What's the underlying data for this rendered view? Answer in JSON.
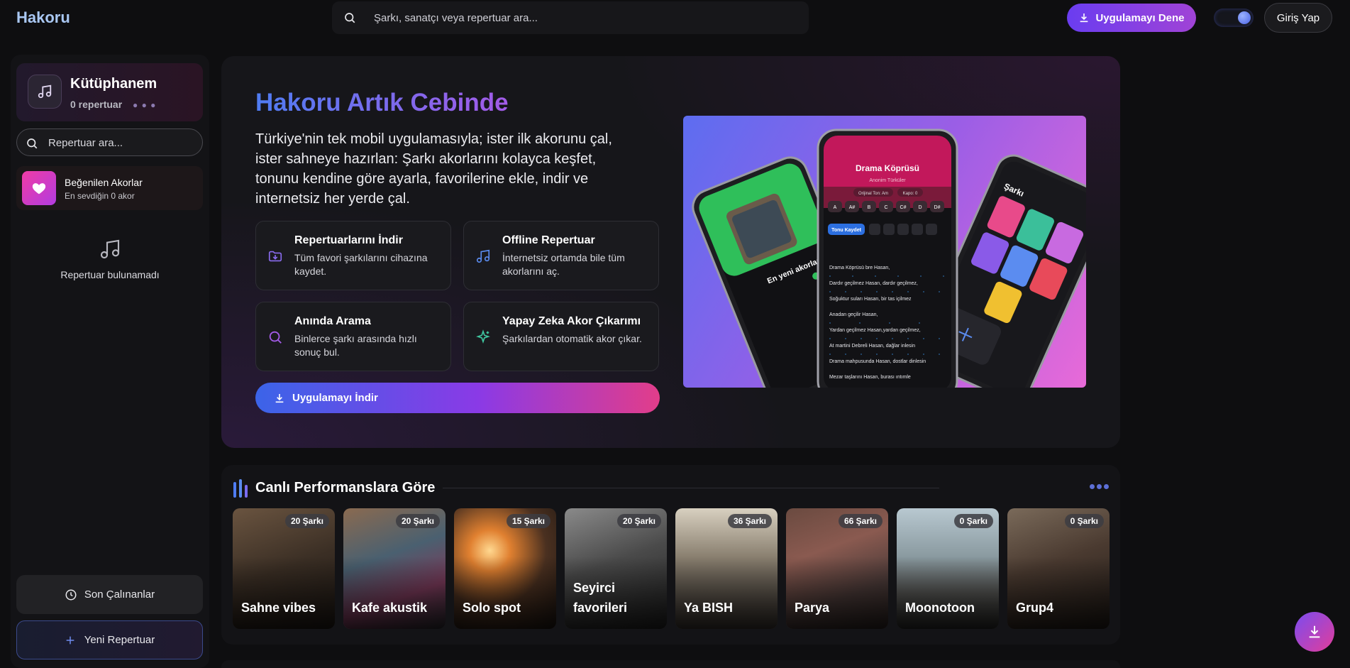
{
  "app": {
    "name": "Hakoru"
  },
  "header": {
    "search_placeholder": "Şarkı, sanatçı veya repertuar ara...",
    "try_app_label": "Uygulamayı Dene",
    "login_label": "Giriş Yap"
  },
  "sidebar": {
    "library_title": "Kütüphanem",
    "library_count": "0 repertuar",
    "search_placeholder": "Repertuar ara...",
    "liked_title": "Beğenilen Akorlar",
    "liked_sub": "En sevdiğin 0 akor",
    "empty_text": "Repertuar bulunamadı",
    "recent_label": "Son Çalınanlar",
    "new_label": "Yeni Repertuar"
  },
  "hero": {
    "title": "Hakoru Artık Cebinde",
    "description": "Türkiye'nin tek mobil uygulamasıyla; ister ilk akorunu çal, ister sahneye hazırlan: Şarkı akorlarını kolayca keşfet, tonunu kendine göre ayarla, favorilerine ekle, indir ve internetsiz her yerde çal.",
    "features": [
      {
        "title": "Repertuarlarını İndir",
        "desc": "Tüm favori şarkılarını cihazına kaydet.",
        "icon": "download-folder-icon"
      },
      {
        "title": "Offline Repertuar",
        "desc": "İnternetsiz ortamda bile tüm akorlarını aç.",
        "icon": "music-note-icon"
      },
      {
        "title": "Anında Arama",
        "desc": "Binlerce şarkı arasında hızlı sonuç bul.",
        "icon": "search-icon"
      },
      {
        "title": "Yapay Zeka Akor Çıkarımı",
        "desc": "Şarkılardan otomatik akor çıkar.",
        "icon": "sparkle-icon"
      }
    ],
    "download_label": "Uygulamayı İndir",
    "phone": {
      "song_title": "Drama Köprüsü",
      "artist": "Anonim Türküler",
      "original_key_label": "Orijinal Ton: Am",
      "capo_label": "Kapo: 0",
      "keys": [
        "A",
        "A#",
        "B",
        "C",
        "C#",
        "D",
        "D#"
      ],
      "save_tone_label": "Tonu Kaydet",
      "lyrics": [
        "Drama Köprüsü bre Hasan,",
        "Dardır geçilmez  Hasan, dardır geçilmez,",
        "Soğuktur suları Hasan, bir tas içilmez",
        "Anadan geçilir Hasan,",
        "Yardan geçilmez  Hasan,yardan geçilmez,",
        "At martini Debreli Hasan, dağlar inlesin",
        "Drama mahpusunda Hasan, dostlar dinlesin",
        "Mezar taşlarını Hasan,        burası ıntımle"
      ],
      "left_label": "En yeni akorlar",
      "right_label": "Şarkı"
    }
  },
  "live": {
    "title": "Canlı Performanslara Göre",
    "cards": [
      {
        "name": "Sahne vibes",
        "count": "20 Şarkı"
      },
      {
        "name": "Kafe akustik",
        "count": "20 Şarkı"
      },
      {
        "name": "Solo spot",
        "count": "15 Şarkı"
      },
      {
        "name": "Seyirci favorileri",
        "count": "20 Şarkı"
      },
      {
        "name": "Ya BISH",
        "count": "36 Şarkı"
      },
      {
        "name": "Parya",
        "count": "66 Şarkı"
      },
      {
        "name": "Moonotoon",
        "count": "0 Şarkı"
      },
      {
        "name": "Grup4",
        "count": "0 Şarkı"
      }
    ]
  }
}
